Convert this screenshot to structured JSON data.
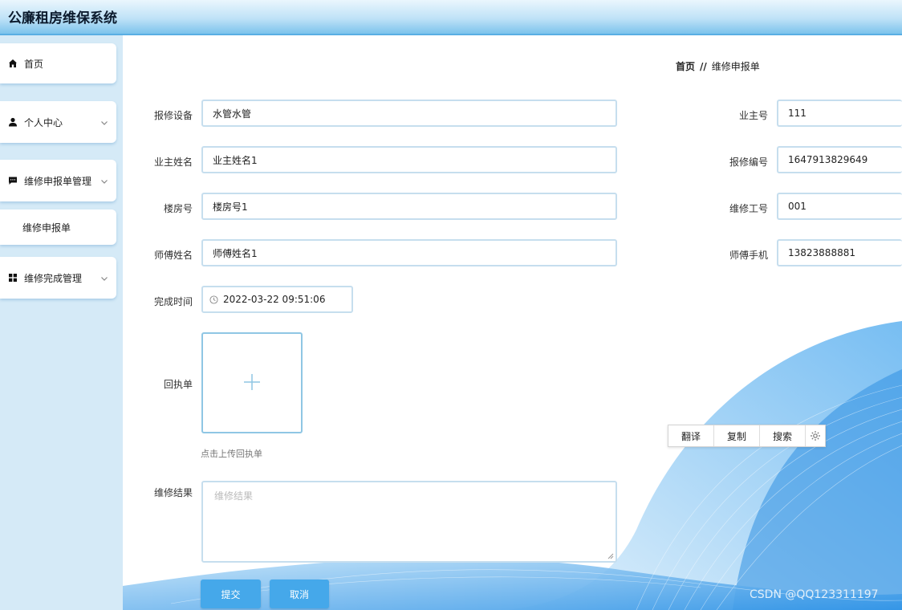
{
  "app": {
    "title": "公廉租房维保系统"
  },
  "sidebar": {
    "items": [
      {
        "label": "首页",
        "icon": "home-icon"
      },
      {
        "label": "个人中心",
        "icon": "user-icon"
      },
      {
        "label": "维修申报单管理",
        "icon": "message-icon"
      },
      {
        "label": "维修申报单",
        "icon": ""
      },
      {
        "label": "维修完成管理",
        "icon": "grid-icon"
      }
    ]
  },
  "breadcrumb": {
    "home": "首页",
    "separator": "//",
    "current": "维修申报单"
  },
  "form": {
    "fields": {
      "device": {
        "label": "报修设备",
        "value": "水管水管"
      },
      "owner_id": {
        "label": "业主号",
        "value": "111"
      },
      "owner_name": {
        "label": "业主姓名",
        "value": "业主姓名1"
      },
      "repair_no": {
        "label": "报修编号",
        "value": "1647913829649"
      },
      "building": {
        "label": "楼房号",
        "value": "楼房号1"
      },
      "worker_no": {
        "label": "维修工号",
        "value": "001"
      },
      "master_name": {
        "label": "师傅姓名",
        "value": "师傅姓名1"
      },
      "master_phone": {
        "label": "师傅手机",
        "value": "13823888881"
      },
      "finish_time": {
        "label": "完成时间",
        "value": "2022-03-22 09:51:06"
      },
      "receipt": {
        "label": "回执单",
        "hint": "点击上传回执单"
      },
      "result": {
        "label": "维修结果",
        "placeholder": "维修结果"
      }
    },
    "submit_label": "提交",
    "cancel_label": "取消"
  },
  "popup": {
    "translate": "翻译",
    "copy": "复制",
    "search": "搜索"
  },
  "watermark": "CSDN @QQ123311197",
  "colors": {
    "accent": "#45a8ea",
    "sidebar_bg": "#d5eaf7",
    "input_border": "#c6deee"
  }
}
